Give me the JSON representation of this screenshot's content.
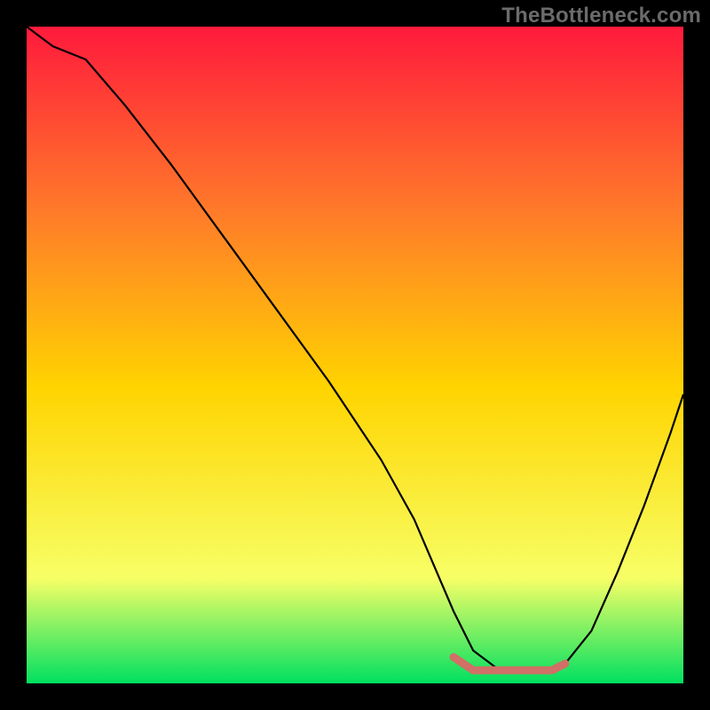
{
  "watermark": "TheBottleneck.com",
  "colors": {
    "bg": "#000000",
    "gradient_top": "#ff1a3c",
    "gradient_upper_mid": "#ff7a2a",
    "gradient_mid": "#ffd400",
    "gradient_lower_mid": "#f7ff66",
    "gradient_bottom": "#00e060",
    "curve": "#000000",
    "highlight": "#d07066"
  },
  "chart_data": {
    "type": "line",
    "title": "",
    "xlabel": "",
    "ylabel": "",
    "xlim": [
      0,
      100
    ],
    "ylim": [
      0,
      100
    ],
    "series": [
      {
        "name": "bottleneck-curve",
        "x": [
          0,
          4,
          9,
          15,
          22,
          30,
          38,
          46,
          54,
          59,
          62,
          65,
          68,
          72,
          76,
          79,
          82,
          86,
          90,
          94,
          98,
          100
        ],
        "y": [
          100,
          97,
          95,
          88,
          79,
          68,
          57,
          46,
          34,
          25,
          18,
          11,
          5,
          2,
          2,
          2,
          3,
          8,
          17,
          27,
          38,
          44
        ]
      }
    ],
    "highlight_segment": {
      "name": "trough-highlight",
      "x": [
        65,
        68,
        70,
        72,
        74,
        76,
        78,
        80,
        82
      ],
      "y": [
        4,
        2,
        2,
        2,
        2,
        2,
        2,
        2,
        3
      ]
    }
  }
}
